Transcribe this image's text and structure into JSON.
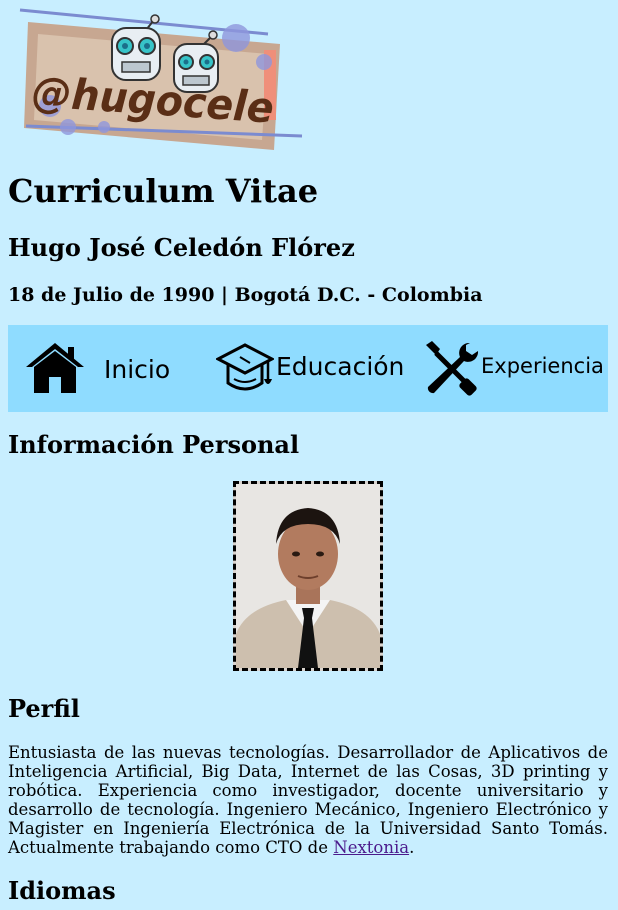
{
  "logo": {
    "text": "@hugocele"
  },
  "page": {
    "title": "Curriculum Vitae",
    "name": "Hugo José Celedón Flórez",
    "birth_info": "18 de Julio de 1990 | Bogotá D.C. - Colombia"
  },
  "nav": {
    "items": [
      {
        "label": "Inicio",
        "icon": "house-icon"
      },
      {
        "label": "Educación",
        "icon": "graduation-cap-icon"
      },
      {
        "label": "Experiencia",
        "icon": "tools-icon"
      }
    ]
  },
  "sections": {
    "info_title": "Información Personal",
    "perfil_title": "Perfil",
    "idiomas_title": "Idiomas"
  },
  "profile": {
    "text": "Entusiasta de las nuevas tecnologías. Desarrollador de Aplicativos de Inteligencia Artificial, Big Data, Internet de las Cosas, 3D printing y robótica. Experiencia como investigador, docente universitario y desarrollo de tecnología. Ingeniero Mecánico, Ingeniero Electrónico y Magister en Ingeniería Electrónica de la Universidad Santo Tomás. Actualmente trabajando como CTO de ",
    "link_text": "Nextonia",
    "suffix": "."
  },
  "colors": {
    "background": "#c8eeff",
    "nav_background": "#8fdcff",
    "link": "#4b1a8c"
  }
}
